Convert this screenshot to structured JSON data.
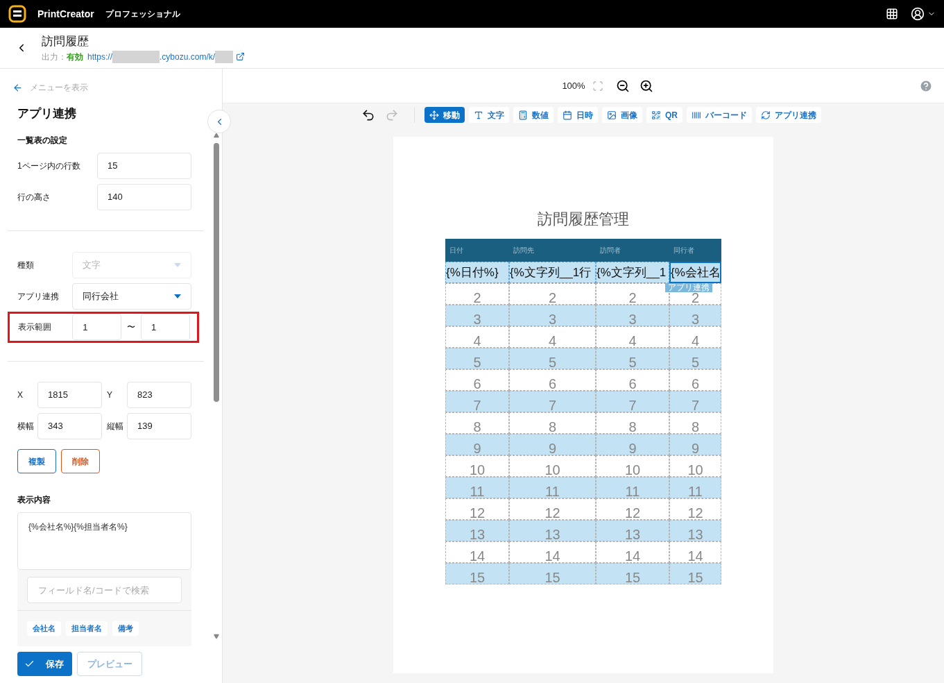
{
  "topbar": {
    "app_name": "PrintCreator",
    "edition": "プロフェッショナル"
  },
  "header": {
    "title": "訪問履歴",
    "output_label": "出力：",
    "output_status": "有効",
    "url_prefix": "https://",
    "url_domain": ".cybozu.com/k/"
  },
  "sidebar": {
    "back_link": "メニューを表示",
    "title": "アプリ連携",
    "section_title": "一覧表の設定",
    "rows_per_page": {
      "label": "1ページ内の行数",
      "value": "15"
    },
    "row_height": {
      "label": "行の高さ",
      "value": "140"
    },
    "type_field": {
      "label": "種類",
      "value": "文字",
      "disabled": true
    },
    "app_link_field": {
      "label": "アプリ連携",
      "value": "同行会社",
      "disabled": false
    },
    "range": {
      "label": "表示範囲",
      "from": "1",
      "separator": "〜",
      "to": "1",
      "highlighted": true
    },
    "position": [
      {
        "label": "X",
        "value": "1815"
      },
      {
        "label": "Y",
        "value": "823"
      },
      {
        "label": "横幅",
        "value": "343"
      },
      {
        "label": "縦幅",
        "value": "139"
      }
    ],
    "duplicate_button": "複製",
    "delete_button": "削除",
    "content_title": "表示内容",
    "content_value": "{%会社名%}{%担当者名%}",
    "field_search_placeholder": "フィールド名/コードで検索",
    "field_chips": [
      "会社名",
      "担当者名",
      "備考"
    ],
    "save_button": "保存",
    "preview_button": "プレビュー"
  },
  "zoombar": {
    "zoom": "100%"
  },
  "tools": [
    {
      "label": "移動",
      "selected": true
    },
    {
      "label": "文字",
      "selected": false
    },
    {
      "label": "数値",
      "selected": false
    },
    {
      "label": "日時",
      "selected": false
    },
    {
      "label": "画像",
      "selected": false
    },
    {
      "label": "QR",
      "selected": false
    },
    {
      "label": "バーコード",
      "selected": false
    },
    {
      "label": "アプリ連携",
      "selected": false
    }
  ],
  "document": {
    "title": "訪問履歴管理",
    "columns": [
      "日付",
      "訪問先",
      "訪問者",
      "同行者"
    ],
    "template_row": [
      {
        "text": "{%日付%}",
        "selected": false
      },
      {
        "text": "{%文字列__1行",
        "selected": false
      },
      {
        "text": "{%文字列__1",
        "selected": false
      },
      {
        "text": "{%会社名",
        "selected": true
      }
    ],
    "selection_label": "アプリ連携",
    "rows": [
      {
        "cells": [
          "2",
          "2",
          "2",
          "2"
        ],
        "shaded": false
      },
      {
        "cells": [
          "3",
          "3",
          "3",
          "3"
        ],
        "shaded": true
      },
      {
        "cells": [
          "4",
          "4",
          "4",
          "4"
        ],
        "shaded": false
      },
      {
        "cells": [
          "5",
          "5",
          "5",
          "5"
        ],
        "shaded": true
      },
      {
        "cells": [
          "6",
          "6",
          "6",
          "6"
        ],
        "shaded": false
      },
      {
        "cells": [
          "7",
          "7",
          "7",
          "7"
        ],
        "shaded": true
      },
      {
        "cells": [
          "8",
          "8",
          "8",
          "8"
        ],
        "shaded": false
      },
      {
        "cells": [
          "9",
          "9",
          "9",
          "9"
        ],
        "shaded": true
      },
      {
        "cells": [
          "10",
          "10",
          "10",
          "10"
        ],
        "shaded": false
      },
      {
        "cells": [
          "11",
          "11",
          "11",
          "11"
        ],
        "shaded": true
      },
      {
        "cells": [
          "12",
          "12",
          "12",
          "12"
        ],
        "shaded": false
      },
      {
        "cells": [
          "13",
          "13",
          "13",
          "13"
        ],
        "shaded": true
      },
      {
        "cells": [
          "14",
          "14",
          "14",
          "14"
        ],
        "shaded": false
      },
      {
        "cells": [
          "15",
          "15",
          "15",
          "15"
        ],
        "shaded": true
      }
    ]
  }
}
